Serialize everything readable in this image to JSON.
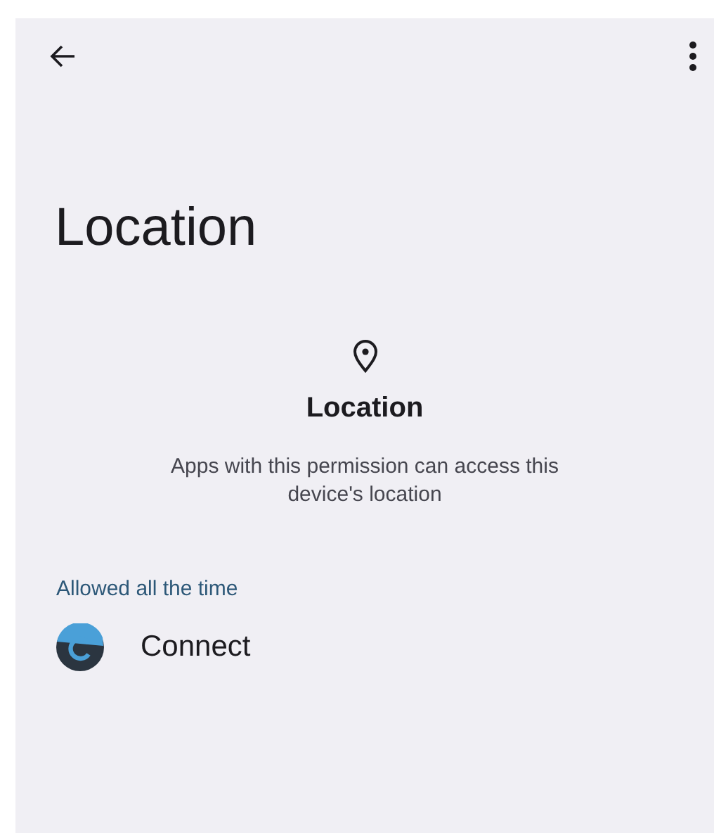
{
  "title": "Location",
  "header": {
    "title": "Location",
    "description": "Apps with this permission can access this device's location"
  },
  "sections": [
    {
      "title": "Allowed all the time",
      "apps": [
        {
          "name": "Connect"
        }
      ]
    }
  ]
}
